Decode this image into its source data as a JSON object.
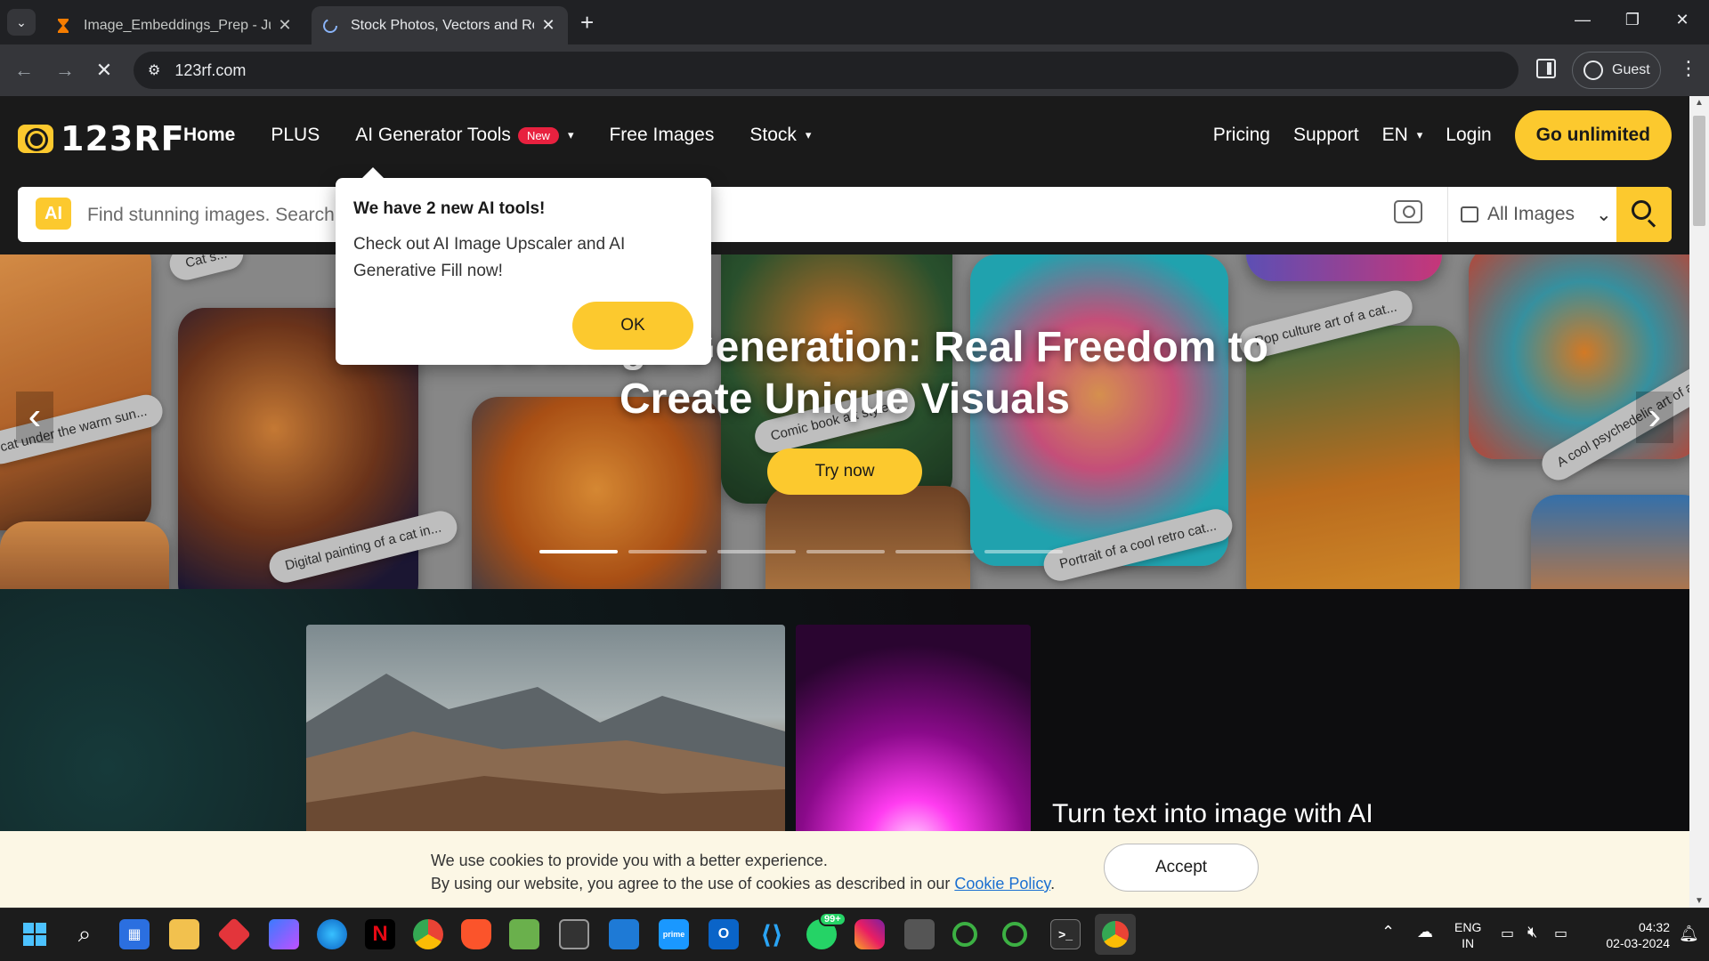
{
  "browser": {
    "tabs": [
      {
        "title": "Image_Embeddings_Prep - Jupyter",
        "active": false
      },
      {
        "title": "Stock Photos, Vectors and Royalty",
        "active": true
      }
    ],
    "new_tab": "+",
    "url": "123rf.com",
    "profile_label": "Guest",
    "window_controls": {
      "minimize": "—",
      "restore": "❐",
      "close": "✕"
    }
  },
  "site": {
    "logo_text": "123RF",
    "nav": {
      "home": "Home",
      "plus": "PLUS",
      "ai_tools": "AI Generator Tools",
      "ai_badge": "New",
      "free_images": "Free Images",
      "stock": "Stock"
    },
    "right_nav": {
      "pricing": "Pricing",
      "support": "Support",
      "lang": "EN",
      "login": "Login",
      "cta": "Go unlimited"
    },
    "search": {
      "ai_icon": "AI",
      "placeholder": "Find stunning images. Search by",
      "type_selected": "All Images"
    },
    "hero": {
      "title_line1": "AI Image Generation: Real Freedom to",
      "title_line2": "Create Unique Visuals",
      "cta": "Try now",
      "chips": [
        "Cat s...",
        "cat under the warm sun...",
        "Digital painting of a cat in...",
        "Comic book art style...",
        "Pop culture art of a cat...",
        "A cool psychedelic art of a...",
        "Portrait of a cool retro cat..."
      ],
      "slides_total": 6,
      "slide_active": 1
    },
    "popup": {
      "heading": "We have 2 new AI tools!",
      "body": "Check out AI Image Upscaler and AI Generative Fill now!",
      "ok": "OK"
    },
    "lower": {
      "heading": "Turn text into image with AI"
    },
    "cookie": {
      "line1": "We use cookies to provide you with a better experience.",
      "line2_prefix": "By using our website, you agree to the use of cookies as described in our ",
      "link": "Cookie Policy",
      "line2_suffix": ".",
      "accept": "Accept"
    }
  },
  "taskbar": {
    "icons": [
      "windows-start",
      "search",
      "store",
      "file-explorer",
      "app-red",
      "copilot",
      "edge",
      "netflix",
      "chrome",
      "brave",
      "notepad-app",
      "terminal-dark",
      "calendar-app",
      "prime-video",
      "outlook",
      "vscode",
      "whatsapp",
      "instagram",
      "console",
      "green-ring-1",
      "green-ring-2",
      "cmd-terminal",
      "chrome-active"
    ],
    "whatsapp_badge": "99+",
    "lang_line1": "ENG",
    "lang_line2": "IN",
    "time": "04:32",
    "date": "02-03-2024",
    "colors": {
      "accent": "#fcc92e",
      "badge_red": "#e8213f"
    }
  }
}
